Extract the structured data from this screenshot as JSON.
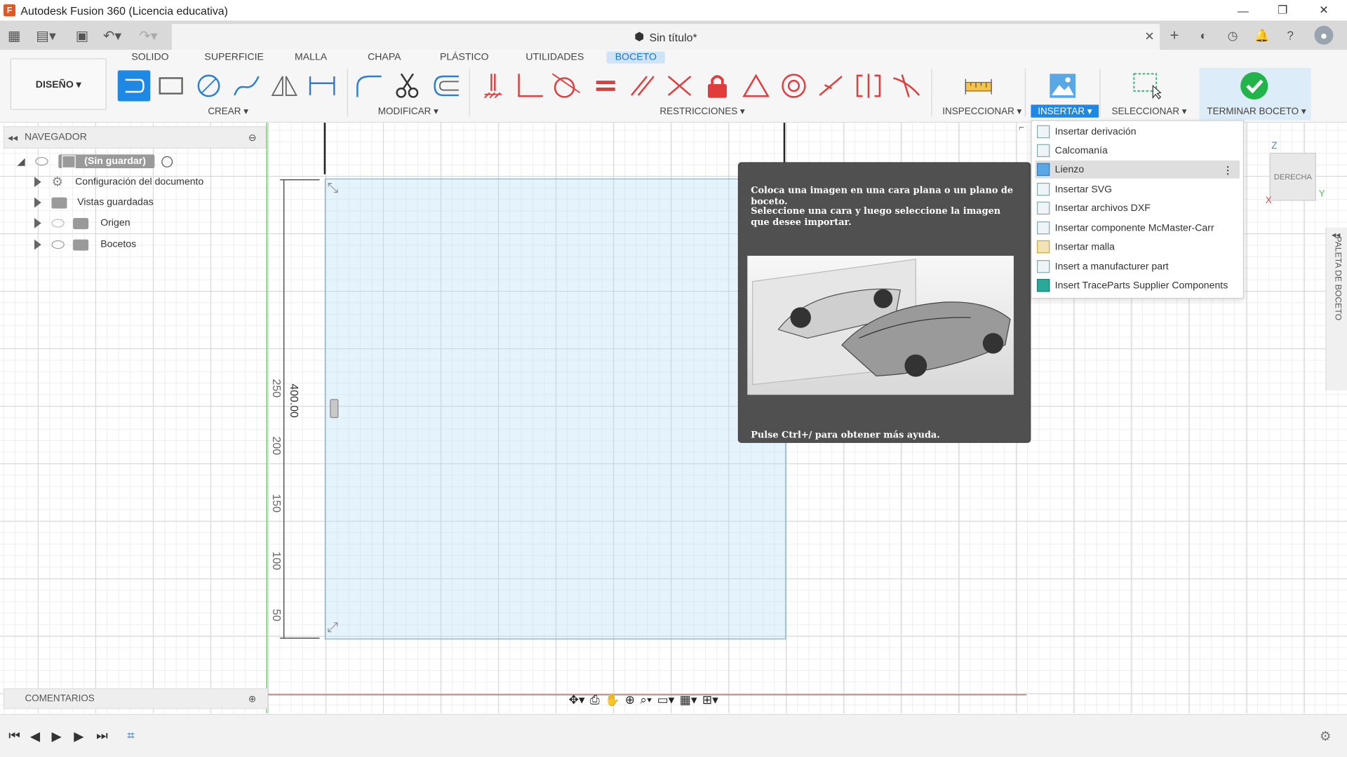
{
  "window": {
    "title": "Autodesk Fusion 360 (Licencia educativa)",
    "min": "—",
    "max": "❐",
    "close": "✕"
  },
  "document": {
    "tab_title": "Sin título*",
    "close": "✕"
  },
  "ribbon": {
    "workspace": "DISEÑO ▾",
    "tabs": [
      "SOLIDO",
      "SUPERFICIE",
      "MALLA",
      "CHAPA",
      "PLÁSTICO",
      "UTILIDADES",
      "BOCETO"
    ],
    "active_tab": "BOCETO",
    "groups": {
      "create": "CREAR ▾",
      "modify": "MODIFICAR ▾",
      "constraints": "RESTRICCIONES ▾",
      "inspect": "INSPECCIONAR ▾",
      "insert": "INSERTAR ▾",
      "select": "SELECCIONAR ▾",
      "finish": "TERMINAR BOCETO ▾"
    }
  },
  "navigator": {
    "title": "NAVEGADOR",
    "root": "(Sin guardar)",
    "items": [
      "Configuración del documento",
      "Vistas guardadas",
      "Origen",
      "Bocetos"
    ]
  },
  "comments": {
    "title": "COMENTARIOS"
  },
  "dimension": {
    "value": "400.00",
    "ruler": [
      "250",
      "200",
      "150",
      "100",
      "50"
    ]
  },
  "tooltip": {
    "line1": "Coloca una imagen en una cara plana o un plano de boceto.",
    "line2": "Seleccione una cara y luego seleccione la imagen que desee importar.",
    "footer": "Pulse Ctrl+/ para obtener más ayuda."
  },
  "insert_menu": {
    "items": [
      "Insertar derivación",
      "Calcomanía",
      "Lienzo",
      "Insertar SVG",
      "Insertar archivos DXF",
      "Insertar componente McMaster-Carr",
      "Insertar malla",
      "Insert a manufacturer part",
      "Insert TraceParts Supplier Components"
    ],
    "highlighted": "Lienzo",
    "more": "⋮"
  },
  "viewcube": {
    "face": "DERECHA",
    "z": "Z",
    "y": "Y",
    "x": "X"
  },
  "palette": {
    "label": "PALETA DE BOCETO"
  },
  "colors": {
    "accent": "#1e88e5",
    "finish_green": "#22b34a",
    "constraint_red": "#e03c3c",
    "axis_red": "#e04848",
    "axis_green": "#55c455"
  }
}
